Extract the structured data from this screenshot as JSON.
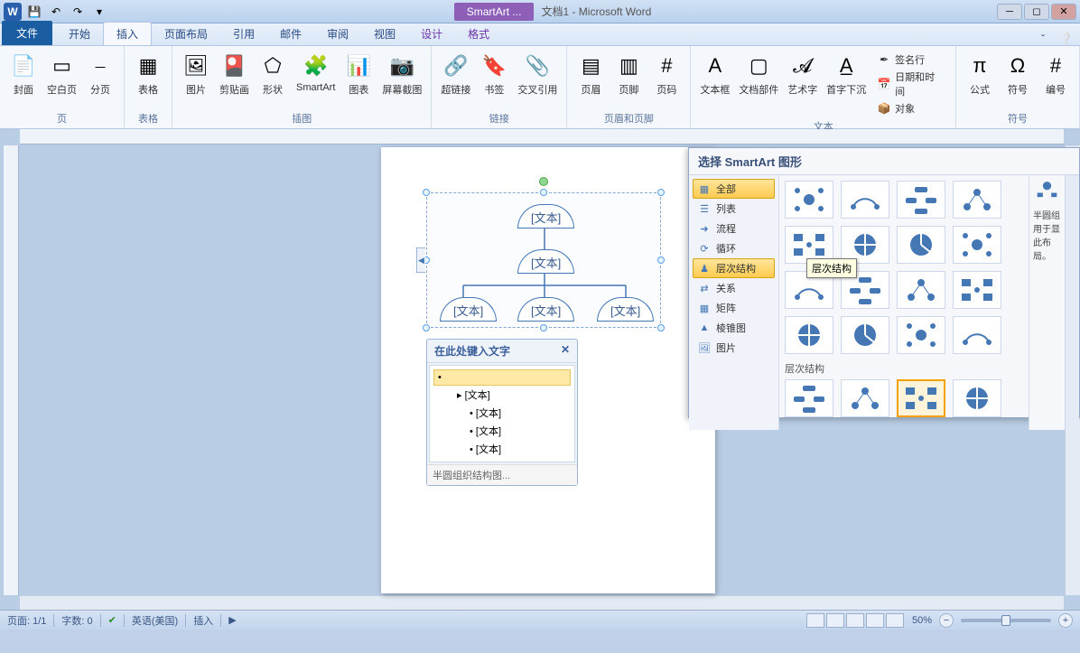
{
  "titlebar": {
    "tool_context": "SmartArt ...",
    "doc_title": "文档1 - Microsoft Word"
  },
  "tabs": {
    "file": "文件",
    "list": [
      "开始",
      "插入",
      "页面布局",
      "引用",
      "邮件",
      "审阅",
      "视图"
    ],
    "ctx": [
      "设计",
      "格式"
    ],
    "active": "插入"
  },
  "ribbon": {
    "groups": [
      {
        "label": "页",
        "items": [
          {
            "cap": "封面",
            "ico": "📄"
          },
          {
            "cap": "空白页",
            "ico": "▭"
          },
          {
            "cap": "分页",
            "ico": "⎯"
          }
        ]
      },
      {
        "label": "表格",
        "items": [
          {
            "cap": "表格",
            "ico": "▦"
          }
        ]
      },
      {
        "label": "插图",
        "items": [
          {
            "cap": "图片",
            "ico": "🖼"
          },
          {
            "cap": "剪贴画",
            "ico": "🎴"
          },
          {
            "cap": "形状",
            "ico": "⬠"
          },
          {
            "cap": "SmartArt",
            "ico": "🧩"
          },
          {
            "cap": "图表",
            "ico": "📊"
          },
          {
            "cap": "屏幕截图",
            "ico": "📷"
          }
        ]
      },
      {
        "label": "链接",
        "items": [
          {
            "cap": "超链接",
            "ico": "🔗"
          },
          {
            "cap": "书签",
            "ico": "🔖"
          },
          {
            "cap": "交叉引用",
            "ico": "📎"
          }
        ]
      },
      {
        "label": "页眉和页脚",
        "items": [
          {
            "cap": "页眉",
            "ico": "▤"
          },
          {
            "cap": "页脚",
            "ico": "▥"
          },
          {
            "cap": "页码",
            "ico": "#"
          }
        ]
      },
      {
        "label": "文本",
        "items": [
          {
            "cap": "文本框",
            "ico": "A"
          },
          {
            "cap": "文档部件",
            "ico": "▢"
          },
          {
            "cap": "艺术字",
            "ico": "𝓐"
          },
          {
            "cap": "首字下沉",
            "ico": "A̲"
          }
        ],
        "stack": [
          {
            "cap": "签名行",
            "ico": "✒"
          },
          {
            "cap": "日期和时间",
            "ico": "📅"
          },
          {
            "cap": "对象",
            "ico": "📦"
          }
        ]
      },
      {
        "label": "符号",
        "items": [
          {
            "cap": "公式",
            "ico": "π"
          },
          {
            "cap": "符号",
            "ico": "Ω"
          },
          {
            "cap": "编号",
            "ico": "#"
          }
        ]
      }
    ]
  },
  "smartart": {
    "nodes": [
      "[文本]",
      "[文本]",
      "[文本]",
      "[文本]",
      "[文本]"
    ]
  },
  "textpane": {
    "title": "在此处键入文字",
    "items": [
      "",
      "[文本]",
      "[文本]",
      "[文本]",
      "[文本]"
    ],
    "footer": "半圆组织结构图..."
  },
  "picker": {
    "title": "选择 SmartArt 图形",
    "categories": [
      "全部",
      "列表",
      "流程",
      "循环",
      "层次结构",
      "关系",
      "矩阵",
      "棱锥图",
      "图片"
    ],
    "selected_cat": "层次结构",
    "tooltip": "层次结构",
    "section_label": "层次结构",
    "preview_text": "半圆组\n用于显\n此布\n局。"
  },
  "statusbar": {
    "page": "页面: 1/1",
    "words": "字数: 0",
    "lang": "英语(美国)",
    "mode": "插入",
    "zoom": "50%"
  }
}
